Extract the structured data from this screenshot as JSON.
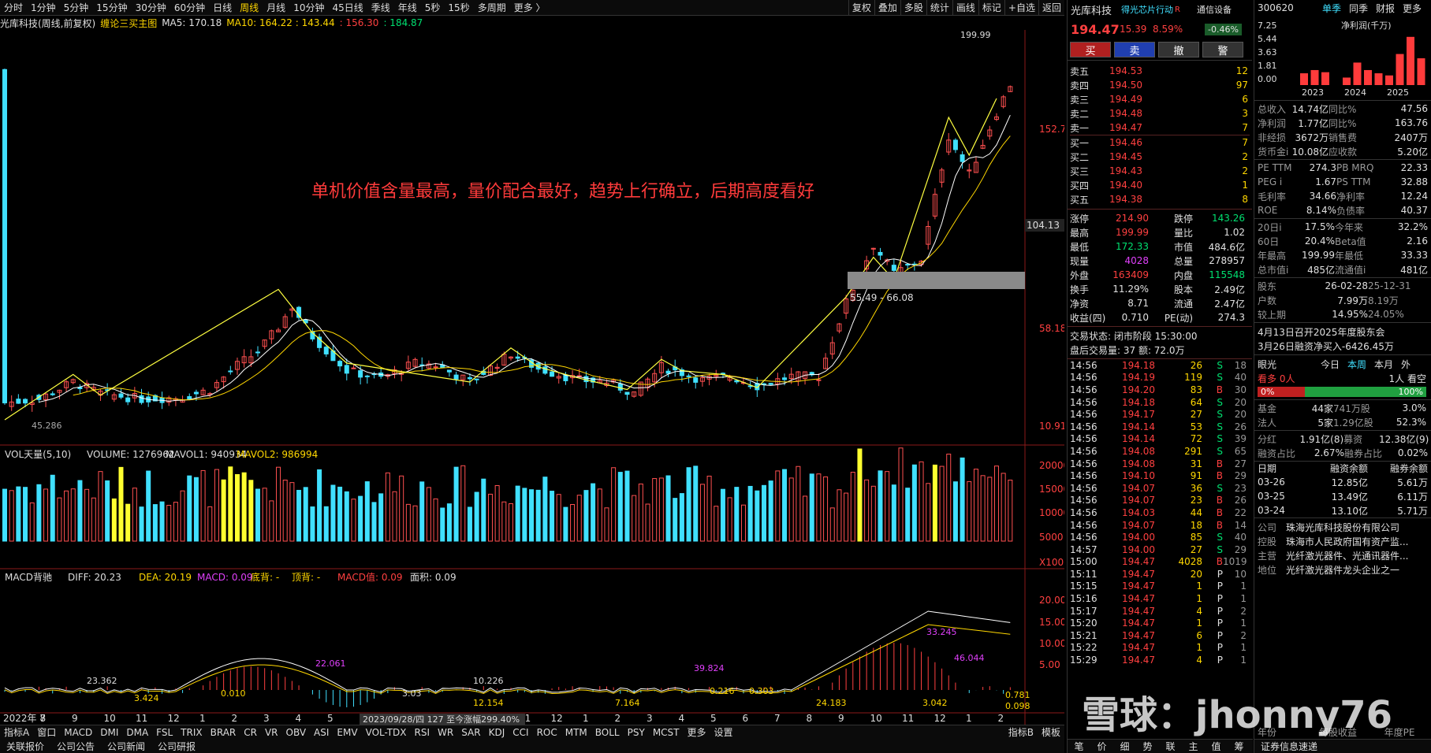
{
  "toolbar": {
    "timeframes": [
      "分时",
      "1分钟",
      "5分钟",
      "15分钟",
      "30分钟",
      "60分钟",
      "日线",
      "周线",
      "月线",
      "10分钟",
      "45日线",
      "季线",
      "年线",
      "5秒",
      "15秒",
      "多周期",
      "更多 〉"
    ],
    "active": "周线",
    "right_tools": [
      "复权",
      "叠加",
      "多股",
      "统计",
      "画线",
      "标记",
      "+自选",
      "返回"
    ]
  },
  "legend": {
    "title": "光库科技(周线,前复权)",
    "indicator": "缠论三买主图",
    "ma5": "MA5: 170.18",
    "ma10": "MA10: 164.22 : 143.44",
    "v3": ": 156.30",
    "v4": ": 184.87"
  },
  "annotation": "单机价值含量最高，量价配合最好，趋势上行确立，后期高度看好",
  "price_labels": {
    "high": "199.99",
    "p1": "152.7",
    "p2": "104.13",
    "p3": "58.18",
    "p4": "10.91",
    "zone": "55.49 - 66.08",
    "lows": "45.286"
  },
  "vol_legend": {
    "name": "VOL天量(5,10)",
    "volume": "VOLUME: 1276962",
    "ma1": "MAVOL1: 940934",
    "ma2": "MAVOL2: 986994",
    "axis": [
      "20000",
      "15000",
      "10000",
      "5000",
      "X100"
    ]
  },
  "macd_legend": {
    "name": "MACD背驰",
    "diff": "DIFF: 20.23",
    "dea": "DEA: 20.19",
    "macd": "MACD: 0.09",
    "dd": "底背: -",
    "db": "顶背: -",
    "mv": "MACD值: 0.09",
    "area": "面积: 0.09",
    "axis": [
      "20.00",
      "15.00",
      "10.00",
      "5.00"
    ],
    "marks": [
      "23.362",
      "3.424",
      "0.010",
      "22.061",
      "3.03",
      "10.226",
      "12.154",
      "39.824",
      "0.216",
      "0.303",
      "7.164",
      "24.183",
      "33.245",
      "3.042",
      "46.044",
      "0.781",
      "0.098"
    ]
  },
  "xaxis": {
    "labels": [
      "2022年 7",
      "8",
      "9",
      "10",
      "11",
      "12",
      "1",
      "2",
      "3",
      "4",
      "5",
      "6",
      "7",
      "8",
      "9",
      "10",
      "11",
      "12",
      "1",
      "2",
      "3",
      "4",
      "5",
      "6",
      "7",
      "8",
      "9",
      "10",
      "11",
      "12",
      "1",
      "2"
    ],
    "stamp": "2023/09/28/四 127 至今涨幅299.40%"
  },
  "bottom_tabs": [
    "指标A",
    "窗口",
    "MACD",
    "DMI",
    "DMA",
    "FSL",
    "TRIX",
    "BRAR",
    "CR",
    "VR",
    "OBV",
    "ASI",
    "EMV",
    "VOL-TDX",
    "RSI",
    "WR",
    "SAR",
    "KDJ",
    "CCI",
    "ROC",
    "MTM",
    "BOLL",
    "PSY",
    "MCST",
    "更多",
    "设置"
  ],
  "bottom_right": [
    "指标B",
    "模板"
  ],
  "bottom2": [
    "关联报价",
    "公司公告",
    "公司新闻",
    "公司研报"
  ],
  "quote": {
    "name": "光库科技",
    "sub": "得光芯片行动",
    "rz": "R",
    "sector": "通信设备",
    "sector_chg": "-0.46%",
    "price": "194.47",
    "chg": "15.39",
    "pct": "8.59%",
    "buttons": [
      "买",
      "卖",
      "撤",
      "警"
    ],
    "asks": [
      [
        "卖五",
        "194.53",
        "12"
      ],
      [
        "卖四",
        "194.50",
        "97"
      ],
      [
        "卖三",
        "194.49",
        "6"
      ],
      [
        "卖二",
        "194.48",
        "3"
      ],
      [
        "卖一",
        "194.47",
        "7"
      ]
    ],
    "bids": [
      [
        "买一",
        "194.46",
        "7"
      ],
      [
        "买二",
        "194.45",
        "2"
      ],
      [
        "买三",
        "194.43",
        "2"
      ],
      [
        "买四",
        "194.40",
        "1"
      ],
      [
        "买五",
        "194.38",
        "8"
      ]
    ],
    "stats": [
      [
        "涨停",
        "214.90",
        "跌停",
        "143.26"
      ],
      [
        "最高",
        "199.99",
        "量比",
        "1.02"
      ],
      [
        "最低",
        "172.33",
        "市值",
        "484.6亿"
      ],
      [
        "现量",
        "4028",
        "总量",
        "278957"
      ],
      [
        "外盘",
        "163409",
        "内盘",
        "115548"
      ],
      [
        "换手",
        "11.29%",
        "股本",
        "2.49亿"
      ],
      [
        "净资",
        "8.71",
        "流通",
        "2.47亿"
      ],
      [
        "收益(四)",
        "0.710",
        "PE(动)",
        "274.3"
      ]
    ],
    "state": "交易状态: 闭市阶段 15:30:00",
    "after": "盘后交易量: 37  额: 72.0万",
    "ticks": [
      [
        "14:56",
        "194.18",
        "26",
        "S",
        "18"
      ],
      [
        "14:56",
        "194.19",
        "119",
        "S",
        "40"
      ],
      [
        "14:56",
        "194.20",
        "83",
        "B",
        "30"
      ],
      [
        "14:56",
        "194.18",
        "64",
        "S",
        "20"
      ],
      [
        "14:56",
        "194.17",
        "27",
        "S",
        "20"
      ],
      [
        "14:56",
        "194.14",
        "53",
        "S",
        "26"
      ],
      [
        "14:56",
        "194.14",
        "72",
        "S",
        "39"
      ],
      [
        "14:56",
        "194.08",
        "291",
        "S",
        "65"
      ],
      [
        "14:56",
        "194.08",
        "31",
        "B",
        "27"
      ],
      [
        "14:56",
        "194.10",
        "91",
        "B",
        "29"
      ],
      [
        "14:56",
        "194.07",
        "36",
        "S",
        "23"
      ],
      [
        "14:56",
        "194.07",
        "23",
        "B",
        "26"
      ],
      [
        "14:56",
        "194.03",
        "44",
        "B",
        "22"
      ],
      [
        "14:56",
        "194.07",
        "18",
        "B",
        "14"
      ],
      [
        "14:56",
        "194.00",
        "85",
        "S",
        "40"
      ],
      [
        "14:57",
        "194.00",
        "27",
        "S",
        "29"
      ],
      [
        "15:00",
        "194.47",
        "4028",
        "B",
        "1019"
      ],
      [
        "15:11",
        "194.47",
        "20",
        "P",
        "10"
      ],
      [
        "15:15",
        "194.47",
        "1",
        "P",
        "1"
      ],
      [
        "15:16",
        "194.47",
        "1",
        "P",
        "1"
      ],
      [
        "15:17",
        "194.47",
        "4",
        "P",
        "2"
      ],
      [
        "15:20",
        "194.47",
        "1",
        "P",
        "1"
      ],
      [
        "15:21",
        "194.47",
        "6",
        "P",
        "2"
      ],
      [
        "15:22",
        "194.47",
        "1",
        "P",
        "1"
      ],
      [
        "15:29",
        "194.47",
        "4",
        "P",
        "1"
      ]
    ],
    "footer": [
      "笔",
      "价",
      "细",
      "势",
      "联",
      "主",
      "值",
      "筹"
    ]
  },
  "fin": {
    "code": "300620",
    "tabs": [
      "单季",
      "同季",
      "财报",
      "更多"
    ],
    "chart_title": "净利润(千万)",
    "y": [
      "7.25",
      "5.44",
      "3.63",
      "1.81",
      "0.00"
    ],
    "years": [
      "2023",
      "2024",
      "2025"
    ],
    "bars": [
      0.22,
      0.28,
      0.24,
      0.0,
      0.14,
      0.42,
      0.28,
      0.22,
      0.18,
      0.58,
      0.9,
      0.5
    ],
    "rows": [
      [
        "总收入",
        "14.74亿",
        "同比%",
        "47.56"
      ],
      [
        "净利润",
        "1.77亿",
        "同比%",
        "163.76"
      ],
      [
        "非经损",
        "3672万",
        "销售费",
        "2407万"
      ],
      [
        "货币金i",
        "10.08亿",
        "应收款",
        "5.20亿"
      ]
    ],
    "rows2": [
      [
        "PE TTM",
        "274.3",
        "PB MRQ",
        "22.33"
      ],
      [
        "PEG i",
        "1.67",
        "PS TTM",
        "32.88"
      ],
      [
        "毛利率",
        "34.66",
        "净利率",
        "12.24"
      ],
      [
        "ROE",
        "8.14%",
        "负债率",
        "40.37"
      ]
    ],
    "rows3": [
      [
        "20日i",
        "17.5%",
        "今年来",
        "32.2%"
      ],
      [
        "60日",
        "20.4%",
        "Beta值",
        "2.16"
      ],
      [
        "年最高",
        "199.99",
        "年最低",
        "33.33"
      ],
      [
        "总市值i",
        "485亿",
        "流通值i",
        "481亿"
      ]
    ],
    "holder": [
      [
        "股东",
        "26-02-28",
        "25-12-31"
      ],
      [
        "户数",
        "7.99万",
        "8.19万"
      ],
      [
        "较上期",
        "14.95%",
        "24.05%"
      ]
    ],
    "news": [
      "4月13日召开2025年度股东会",
      "3月26日融资净买入-6426.45万"
    ],
    "sent": {
      "label": "眼光",
      "tabs": [
        "今日",
        "本周",
        "本月",
        "外"
      ],
      "bear": "看多 0人",
      "bull": "1人 看空",
      "bear_pct": "0%",
      "bull_pct": "100%"
    },
    "inst": [
      [
        "基金",
        "44家",
        "741万股",
        "3.0%"
      ],
      [
        "法人",
        "5家",
        "1.29亿股",
        "52.3%"
      ]
    ],
    "float": [
      [
        "分红",
        "1.91亿(8)",
        "募资",
        "12.38亿(9)"
      ],
      [
        "融资占比",
        "2.67%",
        "融券占比",
        "0.02%"
      ]
    ],
    "margin_head": [
      "日期",
      "融资余额",
      "融券余额"
    ],
    "margin": [
      [
        "03-26",
        "12.85亿",
        "5.61万"
      ],
      [
        "03-25",
        "13.49亿",
        "6.11万"
      ],
      [
        "03-24",
        "13.10亿",
        "5.71万"
      ]
    ],
    "company": [
      [
        "公司",
        "珠海光库科技股份有限公司"
      ],
      [
        "控股",
        "珠海市人民政府国有资产监..."
      ],
      [
        "主营",
        "光纤激光器件、光通讯器件..."
      ],
      [
        "地位",
        "光纤激光器件龙头企业之一"
      ]
    ],
    "foot": [
      "证券信息速递"
    ],
    "foot2": [
      "年份",
      "每股收益",
      "年度PE"
    ]
  },
  "watermark": "雪球：jhonny76"
}
